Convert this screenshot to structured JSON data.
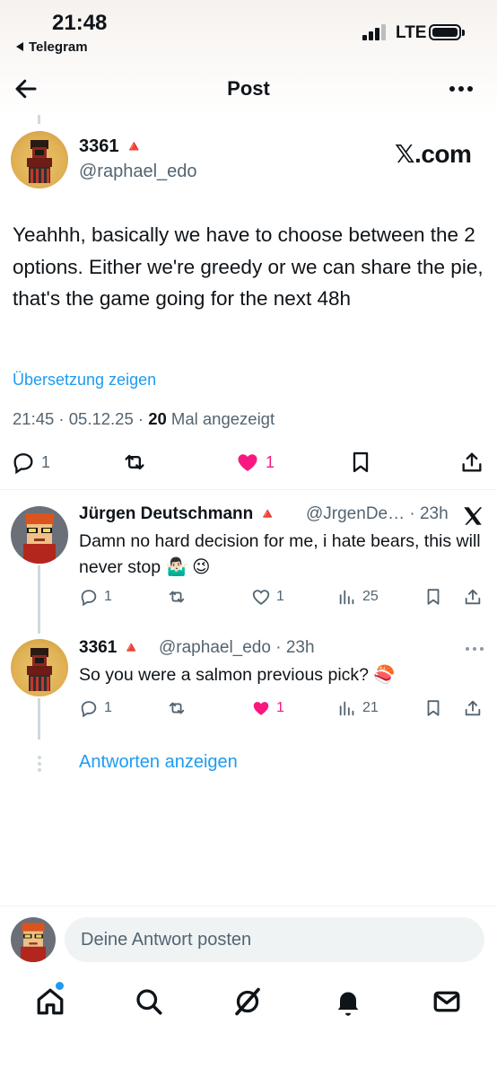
{
  "status_bar": {
    "time": "21:48",
    "back_app": "Telegram",
    "network": "LTE"
  },
  "header": {
    "title": "Post"
  },
  "main_post": {
    "author": "3361",
    "badge": "🔺",
    "handle": "@raphael_edo",
    "source": "𝕏.com",
    "text": "Yeahhh, basically we have to choose between the 2 options. Either we're greedy or we can share the pie, that's the game going for the next 48h",
    "translate_label": "Übersetzung zeigen",
    "timestamp": "21:45 · 05.12.25 · ",
    "views": "20",
    "views_label": " Mal angezeigt",
    "replies": "1",
    "likes": "1"
  },
  "replies": [
    {
      "author": "Jürgen Deutschmann",
      "badge": "🔺",
      "handle": "@JrgenDe… · 23h",
      "text": "Damn no hard decision for me, i hate bears, this will never stop 🤷🏻‍♂️ 😉",
      "replies": "1",
      "likes": "1",
      "views": "25"
    },
    {
      "author": "3361",
      "badge": "🔺",
      "handle": "@raphael_edo · 23h",
      "text": "So you were a salmon previous pick? 🍣",
      "replies": "1",
      "likes": "1",
      "views": "21"
    }
  ],
  "show_replies_label": "Antworten anzeigen",
  "compose": {
    "placeholder": "Deine Antwort posten"
  },
  "colors": {
    "accent": "#1d9bf0",
    "like": "#f91880",
    "muted": "#536471",
    "badge": "#e0245e"
  }
}
